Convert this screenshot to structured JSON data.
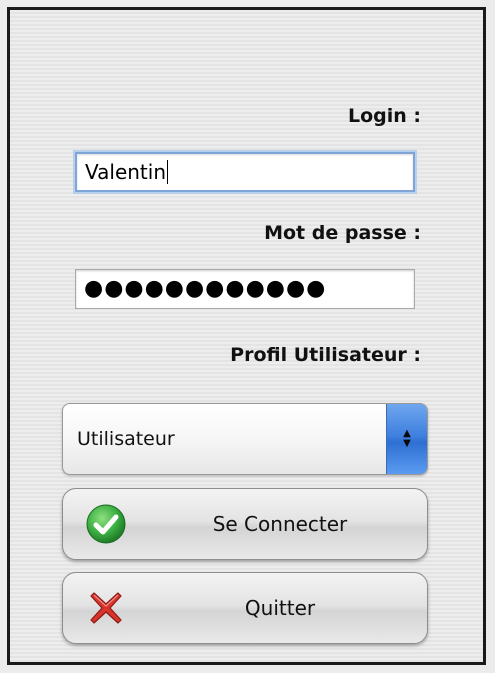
{
  "form": {
    "login_label": "Login :",
    "login_value": "Valentin",
    "password_label": "Mot de passe :",
    "password_value": "●●●●●●●●●●●●",
    "profile_label": "Profil Utilisateur :",
    "profile_selected": "Utilisateur"
  },
  "buttons": {
    "connect_label": "Se Connecter",
    "connect_icon": "check-icon",
    "quit_label": "Quitter",
    "quit_icon": "cross-icon"
  },
  "colors": {
    "check_green": "#3cb043",
    "cross_red": "#d9342b",
    "select_accent": "#3f80e0"
  }
}
